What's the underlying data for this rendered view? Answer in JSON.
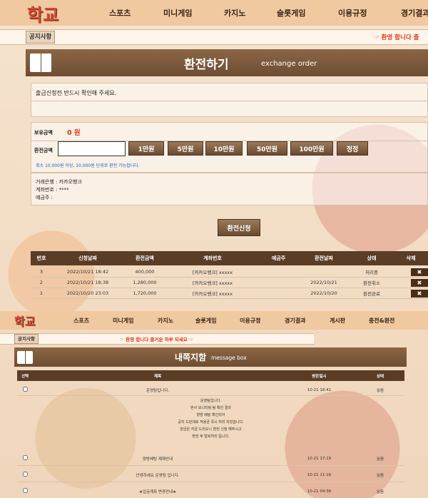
{
  "top_nav": {
    "logo": "학교",
    "items": [
      "스포츠",
      "미니게임",
      "카지노",
      "슬롯게임",
      "이용규정",
      "경기결과"
    ]
  },
  "notice1": {
    "label": "공지사항",
    "text": "☞ 환영 합니다 즐"
  },
  "exchange": {
    "title": "환전하기",
    "subtitle": "exchange order",
    "warning": "출금신청전 반드시 확인해 주세요.",
    "balance_label": "보유금액",
    "balance_value": "0 원",
    "amount_label": "환전금액",
    "amount_value": "",
    "quick": [
      "1만원",
      "5만원",
      "10만원",
      "50만원",
      "100만원",
      "정정"
    ],
    "min_note": "최소 10,000원 이상, 10,000원 단위로 환전 가능합니다.",
    "bank": "거래은행 : 카카오뱅크",
    "account": "계좌번호 : ****",
    "holder": "예금주 :",
    "submit": "환전신청",
    "headers": [
      "번호",
      "신청날짜",
      "환전금액",
      "계좌번호",
      "예금주",
      "환전날짜",
      "상태",
      "삭제"
    ],
    "rows": [
      {
        "no": "3",
        "date": "2022/10/21 18:42",
        "amount": "400,000",
        "account": "[카카오뱅크] xxxxx",
        "holder": "",
        "done": "",
        "status": "처리중",
        "del": "✖"
      },
      {
        "no": "2",
        "date": "2022/10/21 18:38",
        "amount": "1,280,000",
        "account": "[카카오뱅크] xxxxx",
        "holder": "",
        "done": "2022/10/21",
        "status": "환전취소",
        "del": "✖"
      },
      {
        "no": "1",
        "date": "2022/10/20 23:03",
        "amount": "1,720,000",
        "account": "[카카오뱅크] xxxxx",
        "holder": "",
        "done": "2022/10/20",
        "status": "환전완료",
        "del": "✖"
      }
    ]
  },
  "second_nav": {
    "logo": "학교",
    "items": [
      "스포츠",
      "미니게임",
      "카지노",
      "슬롯게임",
      "이용규정",
      "경기결과",
      "게시판",
      "충전&환전"
    ]
  },
  "notice2": {
    "label": "공지사항",
    "text": "☞ 환영 합니다 즐거운 하루 되세요 ☜"
  },
  "message": {
    "title": "내쪽지함",
    "subtitle": "message box",
    "headers": [
      "선택",
      "제목",
      "받은일시",
      "상태"
    ],
    "open": {
      "subject": "운영팀입니다.",
      "date": "10-21 18:41",
      "status": "읽음",
      "body": [
        "운영팀입니다.",
        "본사 모니터링 팀 확인 결과",
        "양방 배팅 확인되어",
        "공지 드린데로 적용금 즉시 처리 되었습니다.",
        "원금은 지금 드리오니 환전 신청 해주시고",
        "환전 후 탈퇴처리 됩니다."
      ]
    },
    "rows": [
      {
        "subject": "양방배팅 제재안내",
        "date": "10-21 17:19",
        "status": "읽음"
      },
      {
        "subject": "안녕하세요 운영팀 입니다.",
        "date": "10-21 11:16",
        "status": "읽음"
      },
      {
        "subject": "★입금계좌 변경안내★",
        "date": "10-21 04:36",
        "status": "읽음"
      }
    ]
  }
}
